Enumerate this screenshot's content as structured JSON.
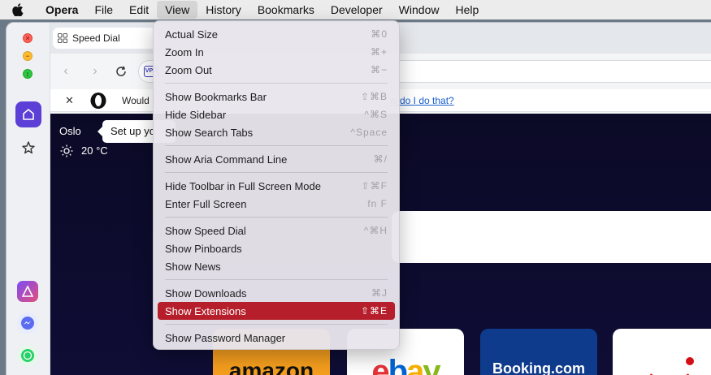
{
  "menubar": {
    "app_name": "Opera",
    "items": [
      "File",
      "Edit",
      "View",
      "History",
      "Bookmarks",
      "Developer",
      "Window",
      "Help"
    ],
    "active": "View"
  },
  "tab": {
    "label": "Speed Dial"
  },
  "infobar": {
    "text": "Would",
    "link": "w do I do that?"
  },
  "weather": {
    "city": "Oslo",
    "temp": "20 °C"
  },
  "tooltip": {
    "text": "Set up yo"
  },
  "tiles": {
    "amazon": "amazon",
    "ebay": "ebay",
    "booking": "Booking.com"
  },
  "view_menu": {
    "groups": [
      [
        {
          "label": "Actual Size",
          "shortcut": "⌘0"
        },
        {
          "label": "Zoom In",
          "shortcut": "⌘+"
        },
        {
          "label": "Zoom Out",
          "shortcut": "⌘−"
        }
      ],
      [
        {
          "label": "Show Bookmarks Bar",
          "shortcut": "⇧⌘B"
        },
        {
          "label": "Hide Sidebar",
          "shortcut": "^⌘S"
        },
        {
          "label": "Show Search Tabs",
          "shortcut": "^Space"
        }
      ],
      [
        {
          "label": "Show Aria Command Line",
          "shortcut": "⌘/"
        }
      ],
      [
        {
          "label": "Hide Toolbar in Full Screen Mode",
          "shortcut": "⇧⌘F"
        },
        {
          "label": "Enter Full Screen",
          "shortcut": "fn F"
        }
      ],
      [
        {
          "label": "Show Speed Dial",
          "shortcut": "^⌘H"
        },
        {
          "label": "Show Pinboards",
          "shortcut": ""
        },
        {
          "label": "Show News",
          "shortcut": ""
        }
      ],
      [
        {
          "label": "Show Downloads",
          "shortcut": "⌘J"
        },
        {
          "label": "Show Extensions",
          "shortcut": "⇧⌘E",
          "selected": true
        }
      ],
      [
        {
          "label": "Show Password Manager",
          "shortcut": ""
        }
      ]
    ]
  },
  "colors": {
    "highlight": "#b51e2a",
    "sidebar_home": "#5b3fd6",
    "content_bg": "#0b0a26"
  }
}
